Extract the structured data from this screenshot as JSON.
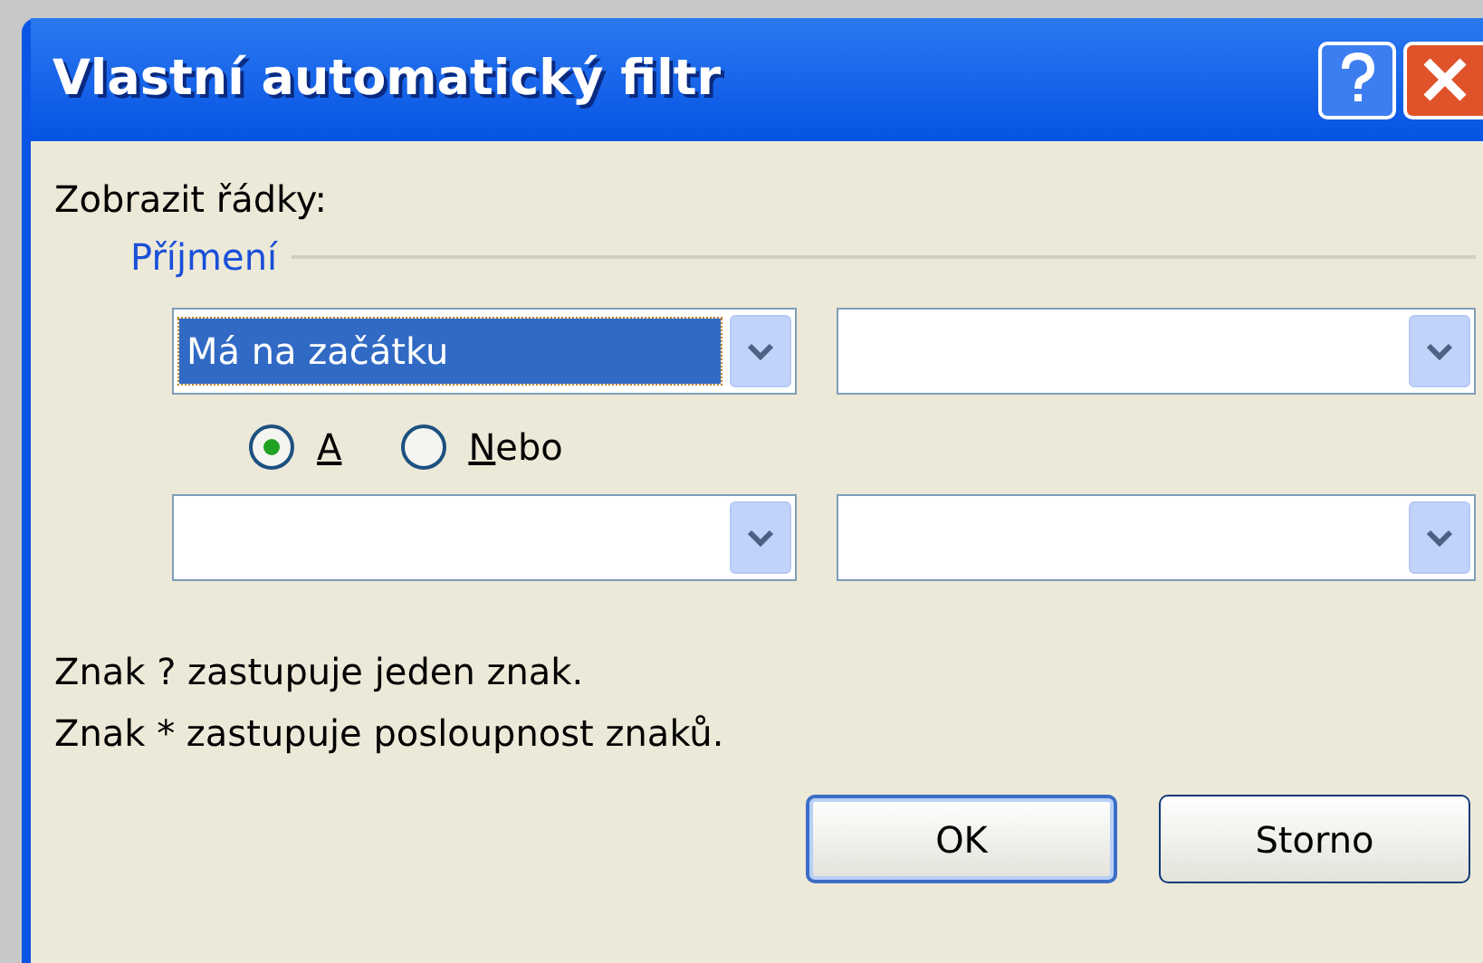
{
  "window": {
    "title": "Vlastní automatický filtr"
  },
  "label": "Zobrazit řádky:",
  "group": {
    "title": "Příjmení"
  },
  "dropdowns": [
    {
      "kind": "dropdown",
      "value": "Má na začátku",
      "highlighted": true
    },
    {
      "kind": "dropdown"
    },
    {
      "kind": "dropdown"
    },
    {
      "kind": "dropdown"
    }
  ],
  "join": [
    {
      "label": "A",
      "selected": true
    },
    {
      "label": "Nebo",
      "selected": false
    }
  ],
  "hints": [
    "Znak ? zastupuje jeden znak.",
    "Znak * zastupuje posloupnost znaků."
  ],
  "buttons": [
    {
      "label": "OK",
      "default": true
    },
    {
      "label": "Storno",
      "default": false
    }
  ]
}
